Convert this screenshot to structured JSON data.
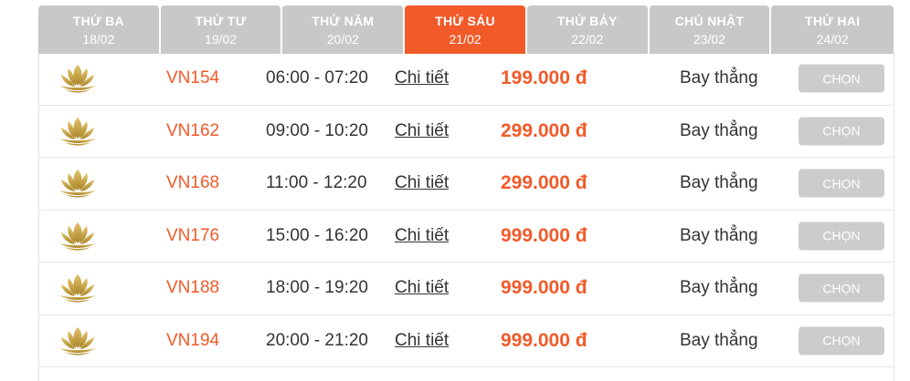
{
  "tabs": [
    {
      "day": "THỨ BA",
      "date": "18/02"
    },
    {
      "day": "THỨ TƯ",
      "date": "19/02"
    },
    {
      "day": "THỨ NĂM",
      "date": "20/02"
    },
    {
      "day": "THỨ SÁU",
      "date": "21/02"
    },
    {
      "day": "THỨ BẢY",
      "date": "22/02"
    },
    {
      "day": "CHỦ NHẬT",
      "date": "23/02"
    },
    {
      "day": "THỨ HAI",
      "date": "24/02"
    }
  ],
  "active_tab": 3,
  "flights": [
    {
      "code": "VN154",
      "time": "06:00 - 07:20",
      "detail": "Chi tiết",
      "price": "199.000 đ",
      "type": "Bay thẳng",
      "button": "CHỌN"
    },
    {
      "code": "VN162",
      "time": "09:00 - 10:20",
      "detail": "Chi tiết",
      "price": "299.000 đ",
      "type": "Bay thẳng",
      "button": "CHỌN"
    },
    {
      "code": "VN168",
      "time": "11:00 - 12:20",
      "detail": "Chi tiết",
      "price": "299.000 đ",
      "type": "Bay thẳng",
      "button": "CHỌN"
    },
    {
      "code": "VN176",
      "time": "15:00 - 16:20",
      "detail": "Chi tiết",
      "price": "999.000 đ",
      "type": "Bay thẳng",
      "button": "CHỌN"
    },
    {
      "code": "VN188",
      "time": "18:00 - 19:20",
      "detail": "Chi tiết",
      "price": "999.000 đ",
      "type": "Bay thẳng",
      "button": "CHỌN"
    },
    {
      "code": "VN194",
      "time": "20:00 - 21:20",
      "detail": "Chi tiết",
      "price": "999.000 đ",
      "type": "Bay thẳng",
      "button": "CHỌN"
    }
  ],
  "airline_logo_icon": "lotus-logo-icon",
  "colors": {
    "accent": "#f25a29",
    "tab_inactive": "#c8c8c8",
    "button": "#cccccc",
    "logo_gold": "#c9a64a"
  }
}
